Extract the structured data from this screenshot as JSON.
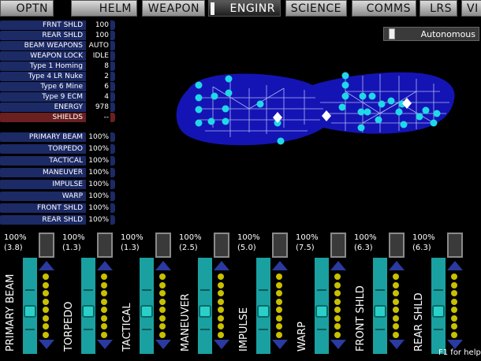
{
  "tabs": [
    {
      "label": "OPTN",
      "selected": false
    },
    {
      "label": "HELM",
      "selected": false
    },
    {
      "label": "WEAPON",
      "selected": false
    },
    {
      "label": "ENGINR",
      "selected": true
    },
    {
      "label": "SCIENCE",
      "selected": false
    },
    {
      "label": "COMMS",
      "selected": false
    },
    {
      "label": "LRS",
      "selected": false
    },
    {
      "label": "VI",
      "selected": false
    }
  ],
  "ship_status": [
    {
      "label": "FRNT SHLD",
      "value": "100"
    },
    {
      "label": "REAR SHLD",
      "value": "100"
    },
    {
      "label": "BEAM WEAPONS",
      "value": "AUTO"
    },
    {
      "label": "WEAPON LOCK",
      "value": "IDLE"
    },
    {
      "label": "Type 1 Homing",
      "value": "8"
    },
    {
      "label": "Type 4 LR Nuke",
      "value": "2"
    },
    {
      "label": "Type 6 Mine",
      "value": "6"
    },
    {
      "label": "Type 9 ECM",
      "value": "4"
    },
    {
      "label": "ENERGY",
      "value": "978"
    },
    {
      "label": "SHIELDS",
      "value": "--"
    }
  ],
  "system_health": [
    {
      "label": "PRIMARY BEAM",
      "value": "100%"
    },
    {
      "label": "TORPEDO",
      "value": "100%"
    },
    {
      "label": "TACTICAL",
      "value": "100%"
    },
    {
      "label": "MANEUVER",
      "value": "100%"
    },
    {
      "label": "IMPULSE",
      "value": "100%"
    },
    {
      "label": "WARP",
      "value": "100%"
    },
    {
      "label": "FRONT SHLD",
      "value": "100%"
    },
    {
      "label": "REAR SHLD",
      "value": "100%"
    }
  ],
  "mode_toggle": {
    "label": "Autonomous"
  },
  "power_systems": [
    {
      "name": "PRIMARY BEAM",
      "percent": "100%",
      "power": "(3.8)"
    },
    {
      "name": "TORPEDO",
      "percent": "100%",
      "power": "(1.3)"
    },
    {
      "name": "TACTICAL",
      "percent": "100%",
      "power": "(1.3)"
    },
    {
      "name": "MANEUVER",
      "percent": "100%",
      "power": "(2.5)"
    },
    {
      "name": "IMPULSE",
      "percent": "100%",
      "power": "(5.0)"
    },
    {
      "name": "WARP",
      "percent": "100%",
      "power": "(7.5)"
    },
    {
      "name": "FRONT SHLD",
      "percent": "100%",
      "power": "(6.3)"
    },
    {
      "name": "REAR SHLD",
      "percent": "100%",
      "power": "(6.3)"
    }
  ],
  "help_text": "F1 for help",
  "colors": {
    "hull": "#1414b4",
    "node": "#20d8e8",
    "slider": "#1aa0a0",
    "coolant": "#c8c000"
  }
}
